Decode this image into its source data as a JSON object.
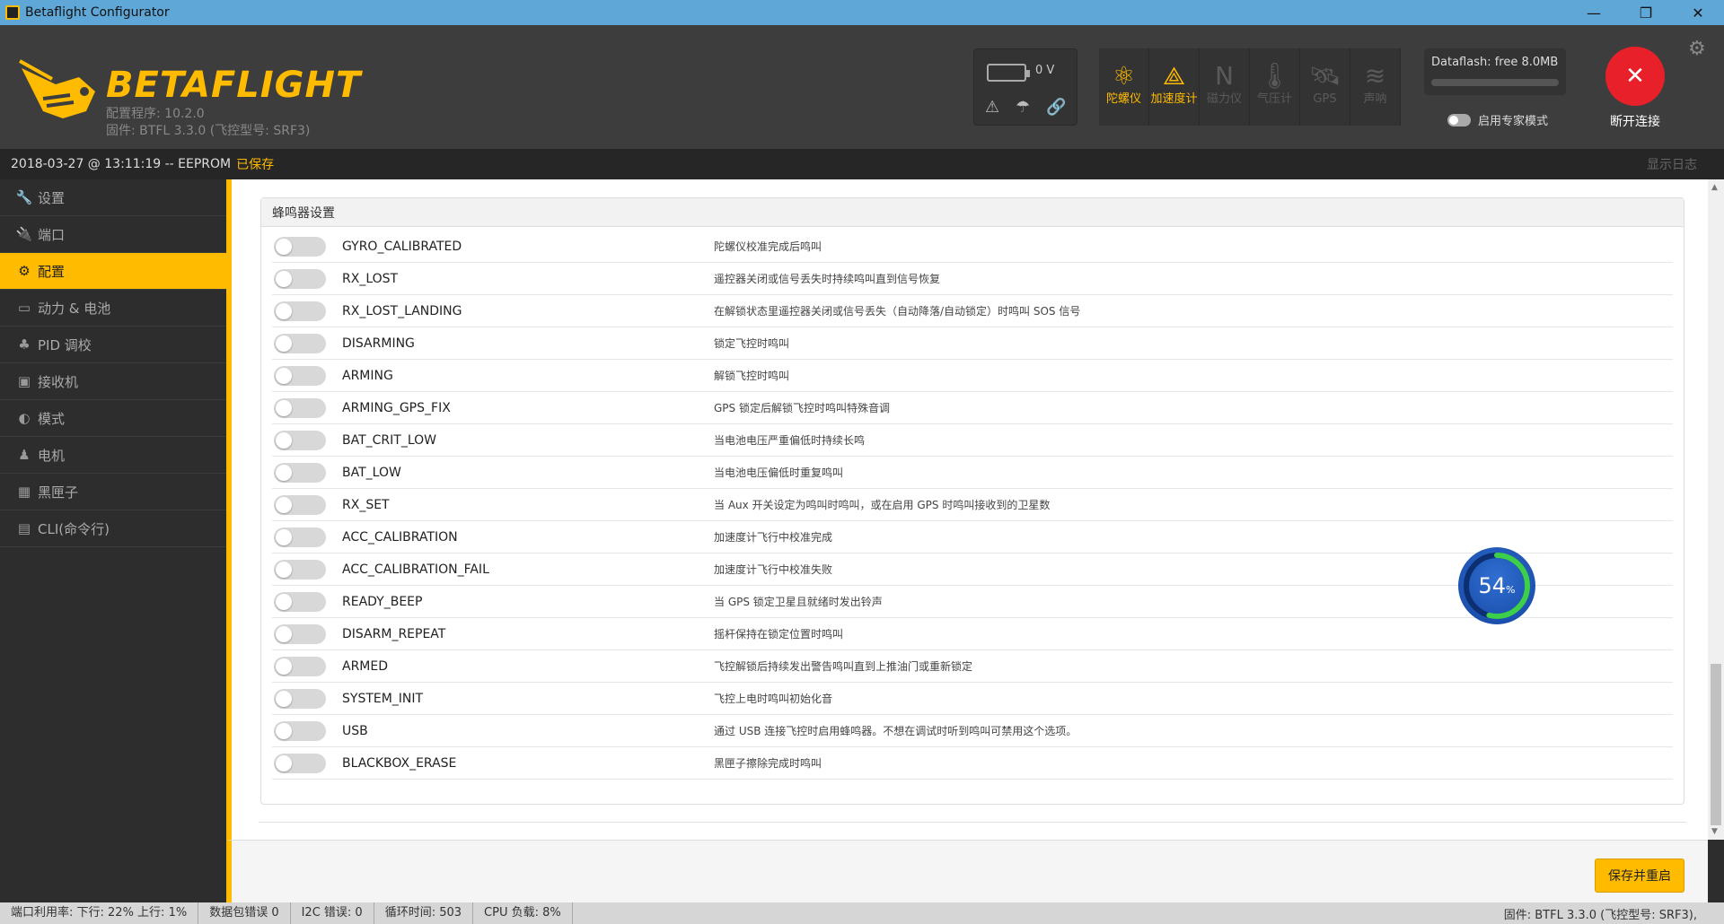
{
  "window": {
    "title": "Betaflight Configurator",
    "minimize": "—",
    "maximize": "❐",
    "close": "✕"
  },
  "header": {
    "logo_text": "BETAFLIGHT",
    "configurator_version": "配置程序: 10.2.0",
    "firmware": "固件: BTFL 3.3.0 (飞控型号: SRF3)",
    "battery_voltage": "0 V",
    "sensors": [
      {
        "label": "陀螺仪",
        "icon": "gyro-icon",
        "state": "on"
      },
      {
        "label": "加速度计",
        "icon": "accel-icon",
        "state": "on"
      },
      {
        "label": "磁力仪",
        "icon": "mag-icon",
        "state": "off"
      },
      {
        "label": "气压计",
        "icon": "baro-icon",
        "state": "off"
      },
      {
        "label": "GPS",
        "icon": "gps-icon",
        "state": "off"
      },
      {
        "label": "声呐",
        "icon": "sonar-icon",
        "state": "off"
      }
    ],
    "dataflash": "Dataflash: free 8.0MB",
    "expert_mode": "启用专家模式",
    "disconnect": "断开连接"
  },
  "status": {
    "datetime": "2018-03-27 @ 13:11:19 -- EEPROM",
    "saved": "已保存",
    "show_log": "显示日志"
  },
  "sidebar": {
    "items": [
      {
        "label": "设置",
        "icon": "wrench-icon",
        "active": false
      },
      {
        "label": "端口",
        "icon": "plug-icon",
        "active": false
      },
      {
        "label": "配置",
        "icon": "gear-icon",
        "active": true
      },
      {
        "label": "动力 & 电池",
        "icon": "battery-icon",
        "active": false
      },
      {
        "label": "PID 调校",
        "icon": "pid-icon",
        "active": false
      },
      {
        "label": "接收机",
        "icon": "receiver-icon",
        "active": false
      },
      {
        "label": "模式",
        "icon": "toggle-icon",
        "active": false
      },
      {
        "label": "电机",
        "icon": "motor-icon",
        "active": false
      },
      {
        "label": "黑匣子",
        "icon": "blackbox-icon",
        "active": false
      },
      {
        "label": "CLI(命令行)",
        "icon": "cli-icon",
        "active": false
      }
    ]
  },
  "beeper": {
    "title": "蜂鸣器设置",
    "rows": [
      {
        "name": "GYRO_CALIBRATED",
        "desc": "陀螺仪校准完成后鸣叫"
      },
      {
        "name": "RX_LOST",
        "desc": "遥控器关闭或信号丢失时持续鸣叫直到信号恢复"
      },
      {
        "name": "RX_LOST_LANDING",
        "desc": "在解锁状态里遥控器关闭或信号丢失（自动降落/自动锁定）时鸣叫 SOS 信号"
      },
      {
        "name": "DISARMING",
        "desc": "锁定飞控时鸣叫"
      },
      {
        "name": "ARMING",
        "desc": "解锁飞控时鸣叫"
      },
      {
        "name": "ARMING_GPS_FIX",
        "desc": "GPS 锁定后解锁飞控时鸣叫特殊音调"
      },
      {
        "name": "BAT_CRIT_LOW",
        "desc": "当电池电压严重偏低时持续长鸣"
      },
      {
        "name": "BAT_LOW",
        "desc": "当电池电压偏低时重复鸣叫"
      },
      {
        "name": "RX_SET",
        "desc": "当 Aux 开关设定为鸣叫时鸣叫，或在启用 GPS 时鸣叫接收到的卫星数"
      },
      {
        "name": "ACC_CALIBRATION",
        "desc": "加速度计飞行中校准完成"
      },
      {
        "name": "ACC_CALIBRATION_FAIL",
        "desc": "加速度计飞行中校准失败"
      },
      {
        "name": "READY_BEEP",
        "desc": "当 GPS 锁定卫星且就绪时发出铃声"
      },
      {
        "name": "DISARM_REPEAT",
        "desc": "摇杆保持在锁定位置时鸣叫"
      },
      {
        "name": "ARMED",
        "desc": "飞控解锁后持续发出警告鸣叫直到上推油门或重新锁定"
      },
      {
        "name": "SYSTEM_INIT",
        "desc": "飞控上电时鸣叫初始化音"
      },
      {
        "name": "USB",
        "desc": "通过 USB 连接飞控时启用蜂鸣器。不想在调试时听到鸣叫可禁用这个选项。"
      },
      {
        "name": "BLACKBOX_ERASE",
        "desc": "黑匣子擦除完成时鸣叫"
      }
    ]
  },
  "gauge": {
    "value": "54",
    "unit": "%",
    "fraction": 0.54
  },
  "save_button": "保存并重启",
  "footer": {
    "port_usage": "端口利用率:   下行: 22% 上行: 1%",
    "packet_errors": "数据包错误 0",
    "i2c_errors": "I2C 错误: 0",
    "cycle_time": "循环时间: 503",
    "cpu_load": "CPU 负载: 8%",
    "firmware": "固件: BTFL 3.3.0 (飞控型号: SRF3),"
  },
  "colors": {
    "accent": "#ffbb00",
    "disconnect": "#e8202a"
  }
}
